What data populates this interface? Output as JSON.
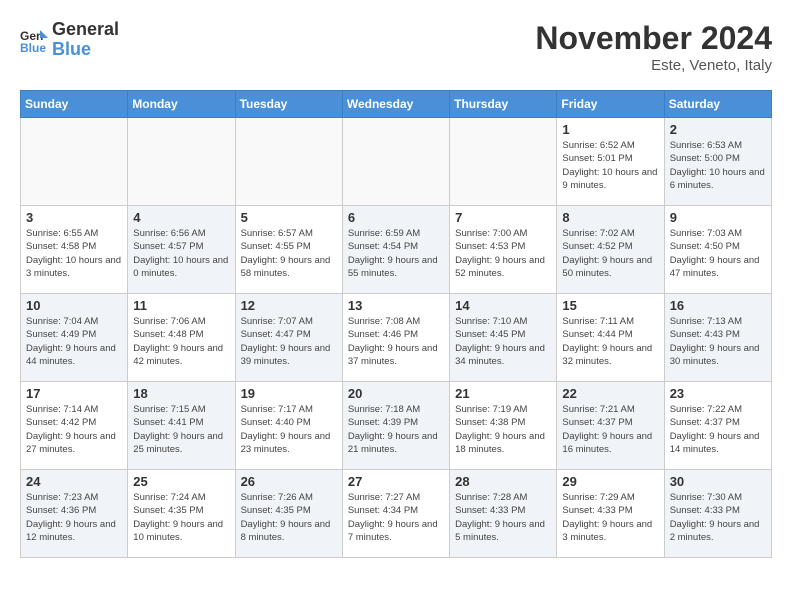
{
  "header": {
    "logo_line1": "General",
    "logo_line2": "Blue",
    "month_title": "November 2024",
    "location": "Este, Veneto, Italy"
  },
  "weekdays": [
    "Sunday",
    "Monday",
    "Tuesday",
    "Wednesday",
    "Thursday",
    "Friday",
    "Saturday"
  ],
  "weeks": [
    [
      {
        "day": "",
        "info": ""
      },
      {
        "day": "",
        "info": ""
      },
      {
        "day": "",
        "info": ""
      },
      {
        "day": "",
        "info": ""
      },
      {
        "day": "",
        "info": ""
      },
      {
        "day": "1",
        "info": "Sunrise: 6:52 AM\nSunset: 5:01 PM\nDaylight: 10 hours and 9 minutes."
      },
      {
        "day": "2",
        "info": "Sunrise: 6:53 AM\nSunset: 5:00 PM\nDaylight: 10 hours and 6 minutes."
      }
    ],
    [
      {
        "day": "3",
        "info": "Sunrise: 6:55 AM\nSunset: 4:58 PM\nDaylight: 10 hours and 3 minutes."
      },
      {
        "day": "4",
        "info": "Sunrise: 6:56 AM\nSunset: 4:57 PM\nDaylight: 10 hours and 0 minutes."
      },
      {
        "day": "5",
        "info": "Sunrise: 6:57 AM\nSunset: 4:55 PM\nDaylight: 9 hours and 58 minutes."
      },
      {
        "day": "6",
        "info": "Sunrise: 6:59 AM\nSunset: 4:54 PM\nDaylight: 9 hours and 55 minutes."
      },
      {
        "day": "7",
        "info": "Sunrise: 7:00 AM\nSunset: 4:53 PM\nDaylight: 9 hours and 52 minutes."
      },
      {
        "day": "8",
        "info": "Sunrise: 7:02 AM\nSunset: 4:52 PM\nDaylight: 9 hours and 50 minutes."
      },
      {
        "day": "9",
        "info": "Sunrise: 7:03 AM\nSunset: 4:50 PM\nDaylight: 9 hours and 47 minutes."
      }
    ],
    [
      {
        "day": "10",
        "info": "Sunrise: 7:04 AM\nSunset: 4:49 PM\nDaylight: 9 hours and 44 minutes."
      },
      {
        "day": "11",
        "info": "Sunrise: 7:06 AM\nSunset: 4:48 PM\nDaylight: 9 hours and 42 minutes."
      },
      {
        "day": "12",
        "info": "Sunrise: 7:07 AM\nSunset: 4:47 PM\nDaylight: 9 hours and 39 minutes."
      },
      {
        "day": "13",
        "info": "Sunrise: 7:08 AM\nSunset: 4:46 PM\nDaylight: 9 hours and 37 minutes."
      },
      {
        "day": "14",
        "info": "Sunrise: 7:10 AM\nSunset: 4:45 PM\nDaylight: 9 hours and 34 minutes."
      },
      {
        "day": "15",
        "info": "Sunrise: 7:11 AM\nSunset: 4:44 PM\nDaylight: 9 hours and 32 minutes."
      },
      {
        "day": "16",
        "info": "Sunrise: 7:13 AM\nSunset: 4:43 PM\nDaylight: 9 hours and 30 minutes."
      }
    ],
    [
      {
        "day": "17",
        "info": "Sunrise: 7:14 AM\nSunset: 4:42 PM\nDaylight: 9 hours and 27 minutes."
      },
      {
        "day": "18",
        "info": "Sunrise: 7:15 AM\nSunset: 4:41 PM\nDaylight: 9 hours and 25 minutes."
      },
      {
        "day": "19",
        "info": "Sunrise: 7:17 AM\nSunset: 4:40 PM\nDaylight: 9 hours and 23 minutes."
      },
      {
        "day": "20",
        "info": "Sunrise: 7:18 AM\nSunset: 4:39 PM\nDaylight: 9 hours and 21 minutes."
      },
      {
        "day": "21",
        "info": "Sunrise: 7:19 AM\nSunset: 4:38 PM\nDaylight: 9 hours and 18 minutes."
      },
      {
        "day": "22",
        "info": "Sunrise: 7:21 AM\nSunset: 4:37 PM\nDaylight: 9 hours and 16 minutes."
      },
      {
        "day": "23",
        "info": "Sunrise: 7:22 AM\nSunset: 4:37 PM\nDaylight: 9 hours and 14 minutes."
      }
    ],
    [
      {
        "day": "24",
        "info": "Sunrise: 7:23 AM\nSunset: 4:36 PM\nDaylight: 9 hours and 12 minutes."
      },
      {
        "day": "25",
        "info": "Sunrise: 7:24 AM\nSunset: 4:35 PM\nDaylight: 9 hours and 10 minutes."
      },
      {
        "day": "26",
        "info": "Sunrise: 7:26 AM\nSunset: 4:35 PM\nDaylight: 9 hours and 8 minutes."
      },
      {
        "day": "27",
        "info": "Sunrise: 7:27 AM\nSunset: 4:34 PM\nDaylight: 9 hours and 7 minutes."
      },
      {
        "day": "28",
        "info": "Sunrise: 7:28 AM\nSunset: 4:33 PM\nDaylight: 9 hours and 5 minutes."
      },
      {
        "day": "29",
        "info": "Sunrise: 7:29 AM\nSunset: 4:33 PM\nDaylight: 9 hours and 3 minutes."
      },
      {
        "day": "30",
        "info": "Sunrise: 7:30 AM\nSunset: 4:33 PM\nDaylight: 9 hours and 2 minutes."
      }
    ]
  ]
}
